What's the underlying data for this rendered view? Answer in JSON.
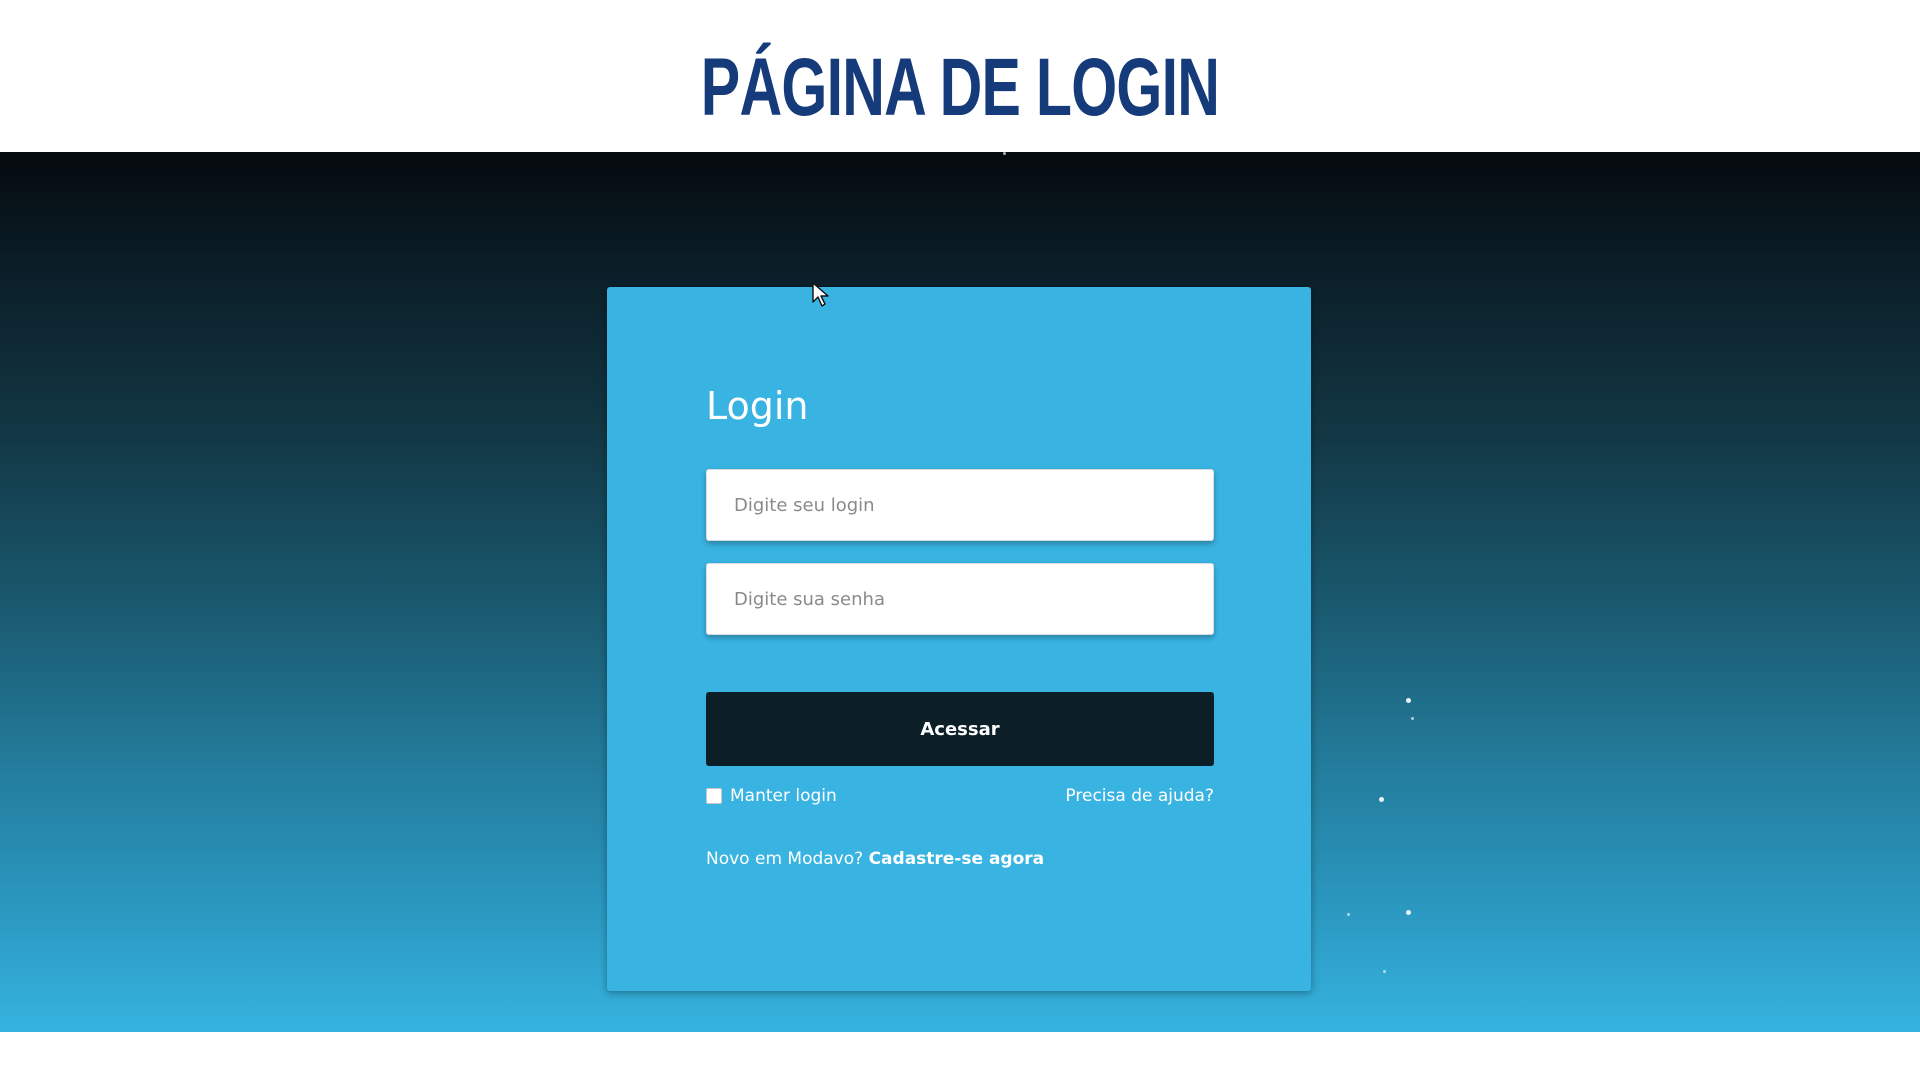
{
  "slide": {
    "title": "PÁGINA DE LOGIN"
  },
  "login_card": {
    "title": "Login",
    "login_placeholder": "Digite seu login",
    "password_placeholder": "Digite sua senha",
    "submit_label": "Acessar",
    "remember_label": "Manter login",
    "help_label": "Precisa de ajuda?",
    "signup_prompt": "Novo em Modavo?",
    "signup_link": "Cadastre-se agora"
  },
  "colors": {
    "title": "#163b7a",
    "card": "#39b4e2",
    "button": "#0c1f27"
  },
  "icons": {
    "cursor": "mouse-pointer-icon"
  }
}
